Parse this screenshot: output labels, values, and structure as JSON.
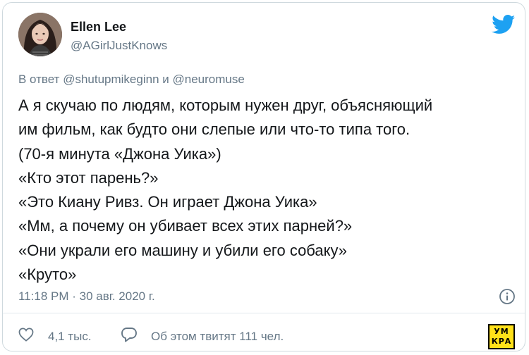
{
  "tweet": {
    "author": {
      "display_name": "Ellen Lee",
      "handle": "@AGirlJustKnows"
    },
    "reply": {
      "prefix": "В ответ",
      "mention1": "@shutupmikeginn",
      "conjunction": "и",
      "mention2": "@neuromuse"
    },
    "lines": [
      "А я скучаю по людям, которым нужен друг, объясняющий",
      "им фильм, как будто они слепые или что-то типа того.",
      "(70-я минута «Джона Уика»)",
      "«Кто этот парень?»",
      "«Это Киану Ривз. Он играет Джона Уика»",
      "«Мм, а почему он убивает всех этих парней?»",
      "«Они украли его машину и убили его собаку»",
      "«Круто»"
    ],
    "timestamp": "11:18 PM · 30 авг. 2020 г.",
    "likes": "4,1 тыс.",
    "discussion": "Об этом твитят 111 чел."
  },
  "logo": {
    "line1": "УМ",
    "line2": "КРА"
  },
  "colors": {
    "twitter_blue": "#1da1f2",
    "secondary_text": "#657786",
    "logo_yellow": "#ffe119"
  },
  "icons": {
    "brand": "twitter-bird-icon",
    "info": "info-icon",
    "like": "heart-icon",
    "reply": "comment-icon"
  }
}
